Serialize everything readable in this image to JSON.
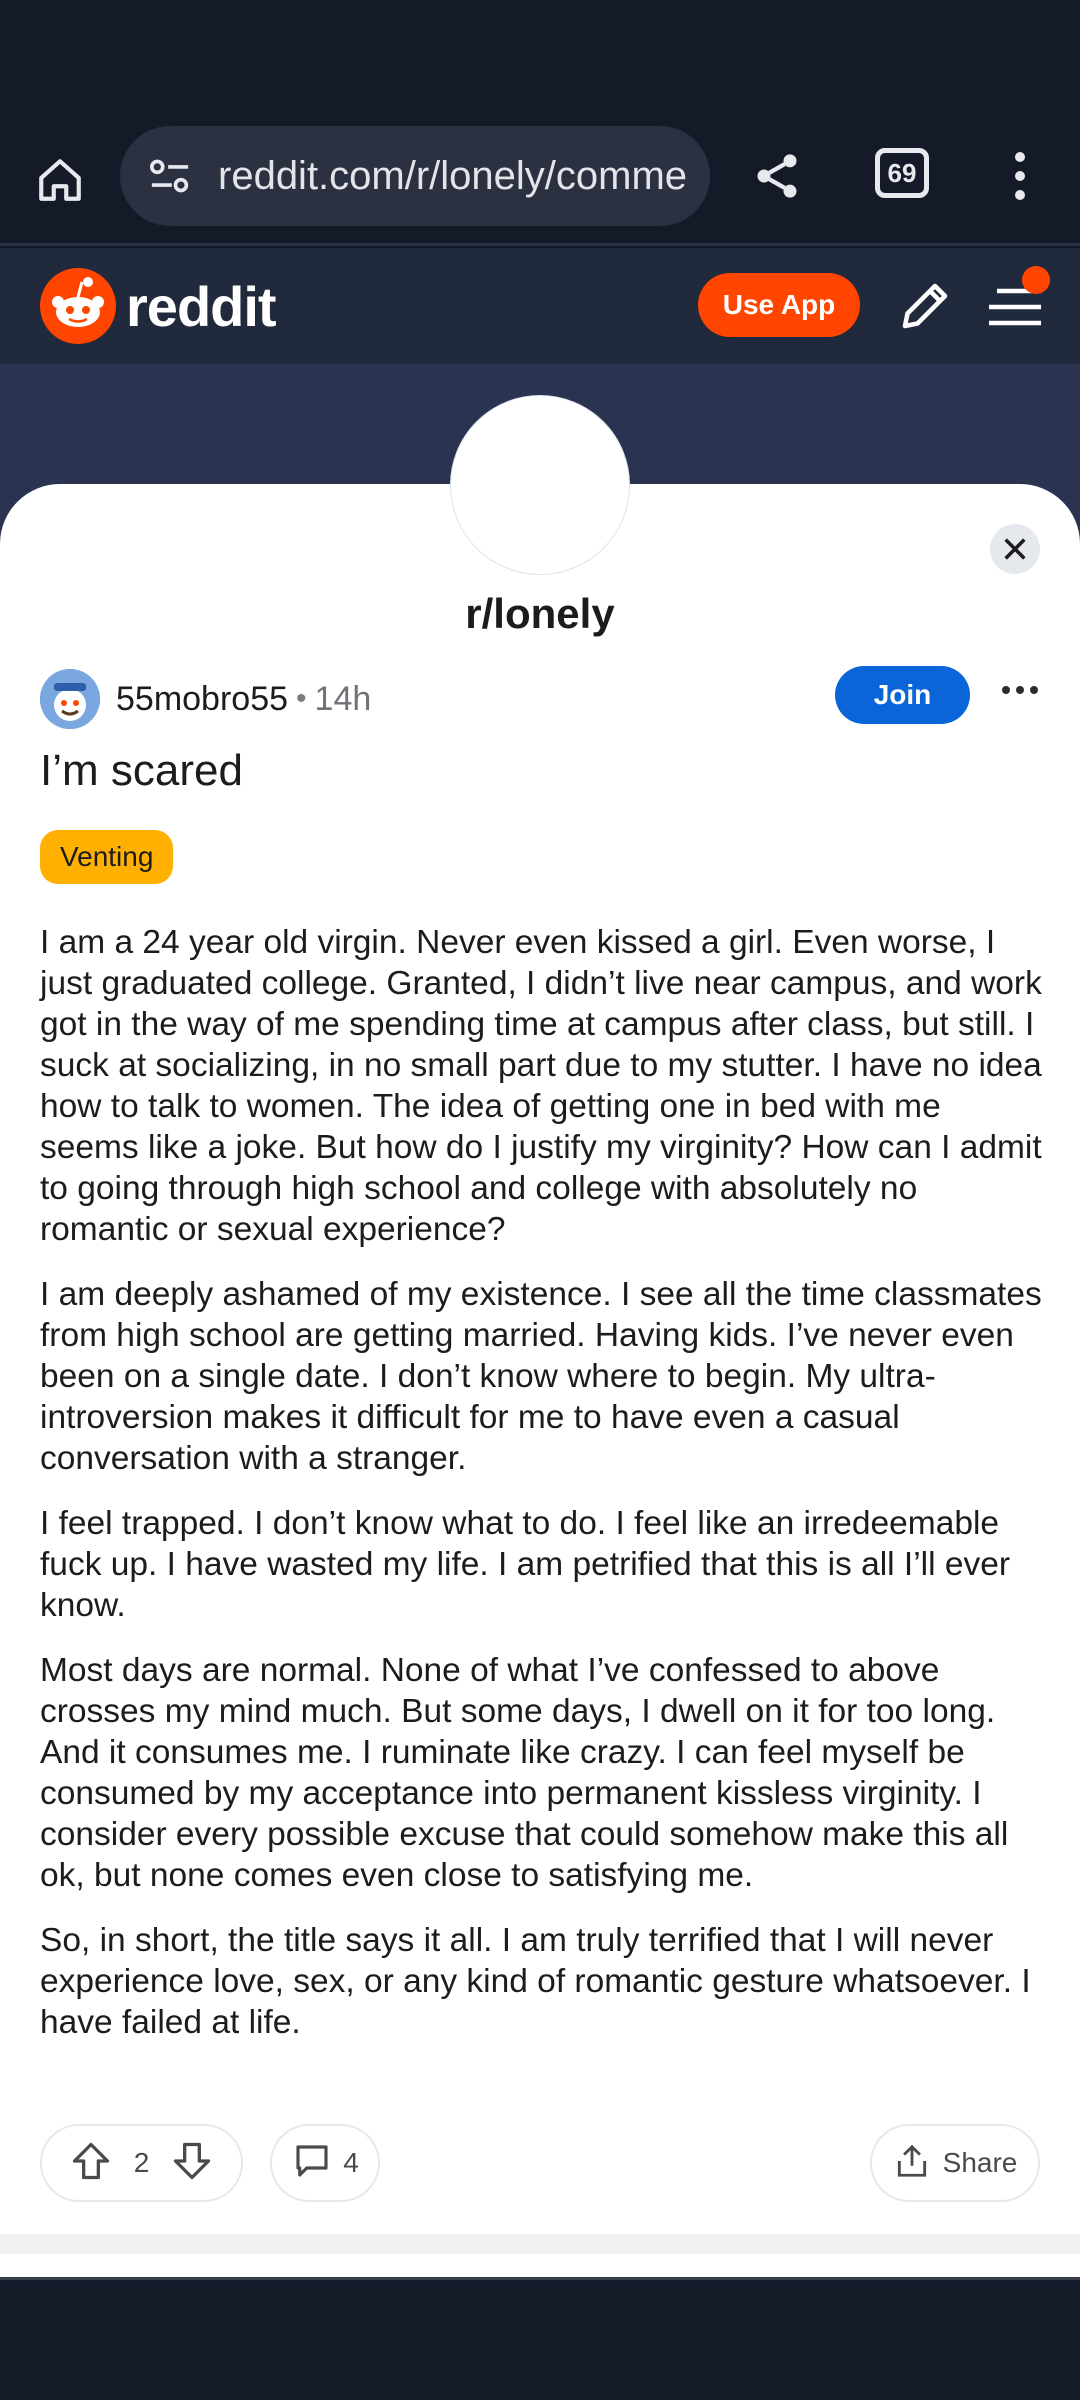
{
  "browser": {
    "url": "reddit.com/r/lonely/comme",
    "tab_count": "69"
  },
  "header": {
    "logo_text": "reddit",
    "use_app_label": "Use App"
  },
  "subreddit": {
    "name": "r/lonely"
  },
  "post": {
    "author": "55mobro55",
    "separator": "•",
    "time": "14h",
    "join_label": "Join",
    "title": "I’m scared",
    "flair": "Venting",
    "paragraphs": [
      "I am a 24 year old virgin. Never even kissed a girl. Even worse, I just graduated college. Granted, I didn’t live near campus, and work got in the way of me spending time at campus after class, but still. I suck at socializing, in no small part due to my stutter. I have no idea how to talk to women. The idea of getting one in bed with me seems like a joke. But how do I justify my virginity? How can I admit to going through high school and college with absolutely no romantic or sexual experience?",
      "I am deeply ashamed of my existence. I see all the time classmates from high school are getting married. Having kids. I’ve never even been on a single date. I don’t know where to begin. My ultra-introversion makes it difficult for me to have even a casual conversation with a stranger.",
      "I feel trapped. I don’t know what to do. I feel like an irredeemable fuck up. I have wasted my life. I am petrified that this is all I’ll ever know.",
      "Most days are normal. None of what I’ve confessed to above crosses my mind much. But some days, I dwell on it for too long. And it consumes me. I ruminate like crazy. I can feel myself be consumed by my acceptance into permanent kissless virginity. I consider every possible excuse that could somehow make this all ok, but none comes even close to satisfying me.",
      "So, in short, the title says it all. I am truly terrified that I will never experience love, sex, or any kind of romantic gesture whatsoever. I have failed at life."
    ],
    "votes": "2",
    "comments": "4",
    "share_label": "Share"
  },
  "colors": {
    "brand": "#ff4500",
    "join": "#0a66d8",
    "flair": "#ffb000"
  }
}
